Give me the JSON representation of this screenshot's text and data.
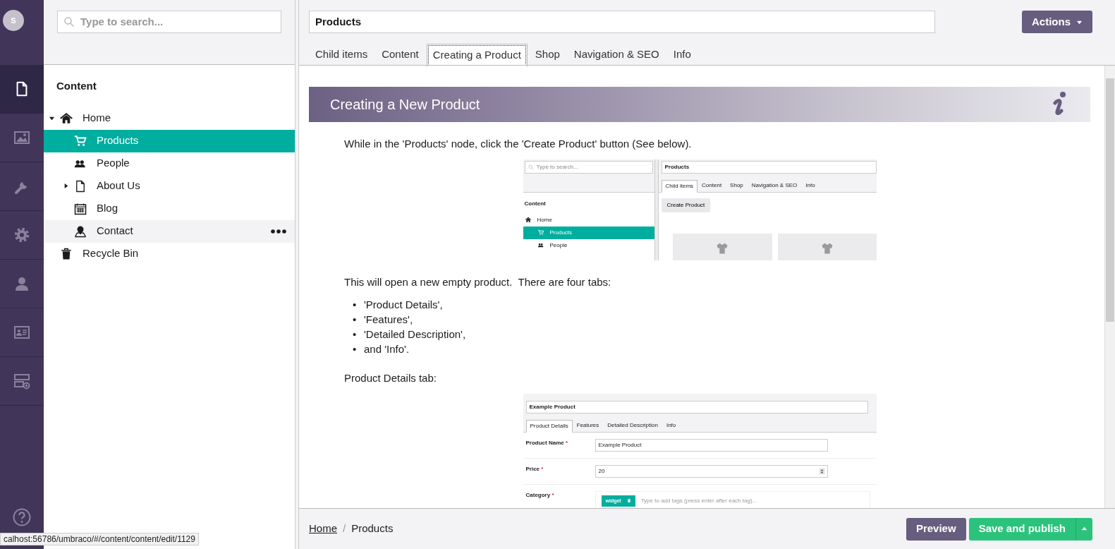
{
  "user": {
    "initial": "S"
  },
  "sections": [
    {
      "kind": "document",
      "selected": true
    },
    {
      "kind": "image",
      "selected": false
    },
    {
      "kind": "wrench",
      "selected": false
    },
    {
      "kind": "gear",
      "selected": false
    },
    {
      "kind": "user",
      "selected": false
    },
    {
      "kind": "card",
      "selected": false
    },
    {
      "kind": "server",
      "selected": false
    }
  ],
  "search": {
    "placeholder": "Type to search..."
  },
  "tree": {
    "title": "Content",
    "items": [
      {
        "label": "Home",
        "kind": "home",
        "expandable": true,
        "expanded": true,
        "selected": false,
        "hovered": false,
        "children": [
          {
            "label": "Products",
            "kind": "cart",
            "expandable": false,
            "expanded": false,
            "selected": true,
            "hovered": false
          },
          {
            "label": "People",
            "kind": "people",
            "expandable": false,
            "expanded": false,
            "selected": false,
            "hovered": false
          },
          {
            "label": "About Us",
            "kind": "document",
            "expandable": true,
            "expanded": false,
            "selected": false,
            "hovered": false
          },
          {
            "label": "Blog",
            "kind": "calendar",
            "expandable": false,
            "expanded": false,
            "selected": false,
            "hovered": false
          },
          {
            "label": "Contact",
            "kind": "pin",
            "expandable": false,
            "expanded": false,
            "selected": false,
            "hovered": true
          }
        ]
      },
      {
        "label": "Recycle Bin",
        "kind": "trash",
        "expandable": false,
        "expanded": false,
        "selected": false,
        "hovered": false
      }
    ]
  },
  "editor": {
    "name": "Products",
    "actions": "Actions",
    "tabs": [
      {
        "label": "Child items",
        "selected": false
      },
      {
        "label": "Content",
        "selected": false
      },
      {
        "label": "Creating a Product",
        "selected": true
      },
      {
        "label": "Shop",
        "selected": false
      },
      {
        "label": "Navigation & SEO",
        "selected": false
      },
      {
        "label": "Info",
        "selected": false
      }
    ]
  },
  "article": {
    "title": "Creating a New Product",
    "blocks": [
      {
        "kind": "paragraph",
        "text": "While in the 'Products' node, click the 'Create Product' button (See below)."
      },
      {
        "kind": "browser",
        "search": {
          "placeholder": "Type to search..."
        },
        "tree": {
          "title": "Content",
          "items": [
            {
              "label": "Home",
              "kind": "home",
              "selected": false
            },
            {
              "label": "Products",
              "kind": "cart",
              "selected": true
            },
            {
              "label": "People",
              "kind": "people",
              "selected": false
            }
          ]
        },
        "name": "Products",
        "tabs": [
          {
            "label": "Child items",
            "selected": true
          },
          {
            "label": "Content",
            "selected": false
          },
          {
            "label": "Shop",
            "selected": false
          },
          {
            "label": "Navigation & SEO",
            "selected": false
          },
          {
            "label": "Info",
            "selected": false
          }
        ],
        "button": "Create Product"
      },
      {
        "kind": "paragraph",
        "text": "This will open a new empty product.  There are four tabs:"
      },
      {
        "kind": "list",
        "items": [
          {
            "marker": "•",
            "text": "'Product Details',"
          },
          {
            "marker": "•",
            "text": "'Features',"
          },
          {
            "marker": "•",
            "text": "'Detailed Description',"
          },
          {
            "marker": "•",
            "text": "and 'Info'."
          }
        ]
      },
      {
        "kind": "paragraph",
        "text": "Product Details tab:"
      },
      {
        "kind": "form",
        "name": "Example Product",
        "tabs": [
          {
            "label": "Product Details",
            "selected": true
          },
          {
            "label": "Features",
            "selected": false
          },
          {
            "label": "Detailed Description",
            "selected": false
          },
          {
            "label": "Info",
            "selected": false
          }
        ],
        "fields": [
          {
            "label": "Product Name",
            "marker": "*",
            "kind": "text",
            "value": "Example Product"
          },
          {
            "label": "Price",
            "marker": "*",
            "kind": "number",
            "value": "20"
          },
          {
            "label": "Category",
            "marker": "*",
            "kind": "tags",
            "tags": [
              "widget"
            ],
            "placeholder": "Type to add tags (press enter after each tag)..."
          }
        ]
      }
    ]
  },
  "breadcrumb": {
    "separator": "/",
    "items": [
      {
        "label": "Home",
        "link": true
      },
      {
        "label": "Products",
        "link": false
      }
    ]
  },
  "buttons": {
    "preview": "Preview",
    "publish": "Save and publish"
  },
  "status_url": "calhost:56786/umbraco/#/content/content/edit/1129"
}
